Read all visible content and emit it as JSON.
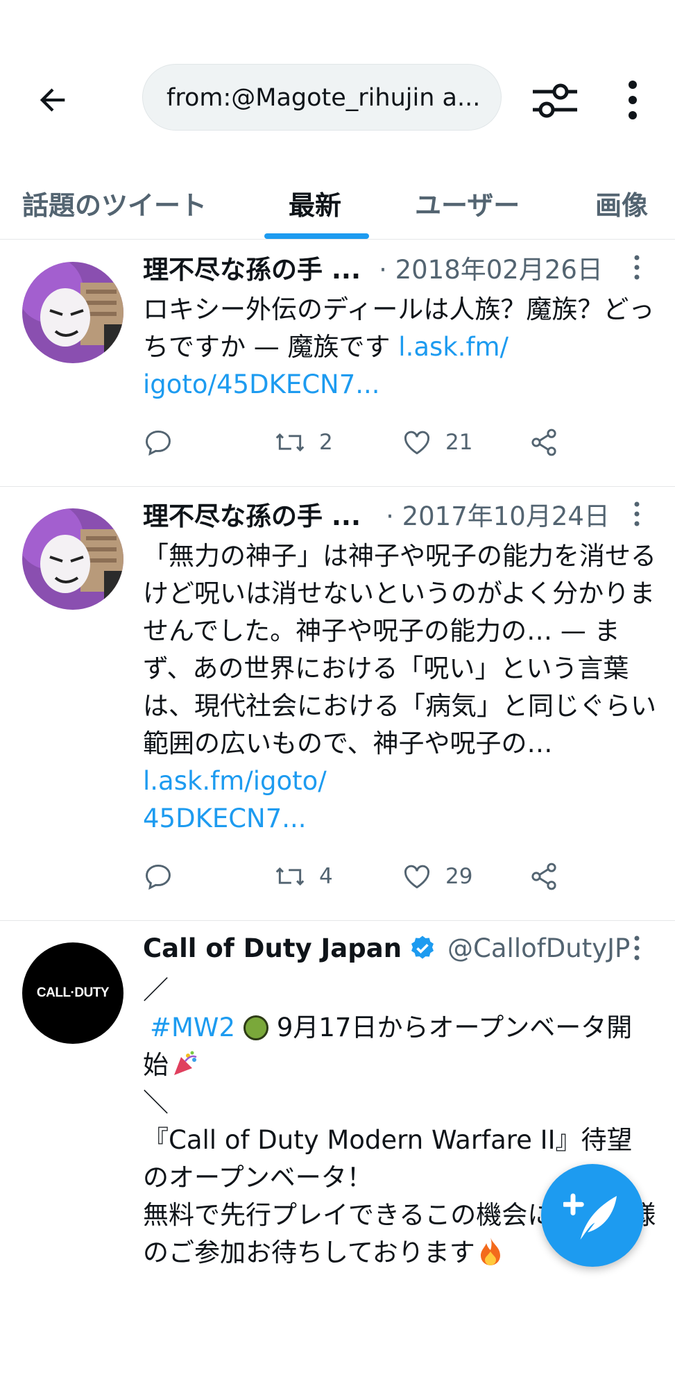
{
  "header": {
    "search_value": "from:@Magote_rihujin a..."
  },
  "tabs": [
    {
      "label": "話題のツイート",
      "active": false
    },
    {
      "label": "最新",
      "active": true
    },
    {
      "label": "ユーザー",
      "active": false
    },
    {
      "label": "画像",
      "active": false
    }
  ],
  "tweets": [
    {
      "name": "理不尽な孫の手 ...",
      "date": "· 2018年02月26日",
      "text": "ロキシー外伝のディールは人族？魔族？どっちですか — 魔族です ",
      "link": "l.ask.fm/\nigoto/45DKECN7...",
      "retweets": "2",
      "likes": "21"
    },
    {
      "name": "理不尽な孫の手 ...",
      "date": "· 2017年10月24日",
      "text": "「無力の神子」は神子や呪子の能力を消せるけど呪いは消せないというのがよく分かりませんでした。神子や呪子の能力の… — まず、あの世界における「呪い」という言葉は、現代社会における「病気」と同じぐらい範囲の広いもので、神子や呪子の… ",
      "link": "l.ask.fm/igoto/\n45DKECN7...",
      "retweets": "4",
      "likes": "29"
    },
    {
      "name": "Call of Duty Japan",
      "handle": "@CallofDutyJP",
      "avatar_text": "CALL·DUTY",
      "line1": "／",
      "hashtag": "#MW2",
      "line2_rest": " 9月17日からオープンベータ開始",
      "line3": "＼",
      "line4": "『Call of Duty Modern Warfare II』待望のオープンベータ！\n無料で先行プレイできるこの機会に是非皆様のご参加お待ちしております"
    }
  ],
  "icons": [
    "back-arrow-icon",
    "filter-icon",
    "more-vertical-icon",
    "reply-icon",
    "retweet-icon",
    "like-icon",
    "share-icon",
    "verified-icon",
    "compose-tweet-icon"
  ],
  "colors": {
    "accent": "#1d9bf0",
    "text": "#0f1419",
    "secondary": "#536471"
  }
}
